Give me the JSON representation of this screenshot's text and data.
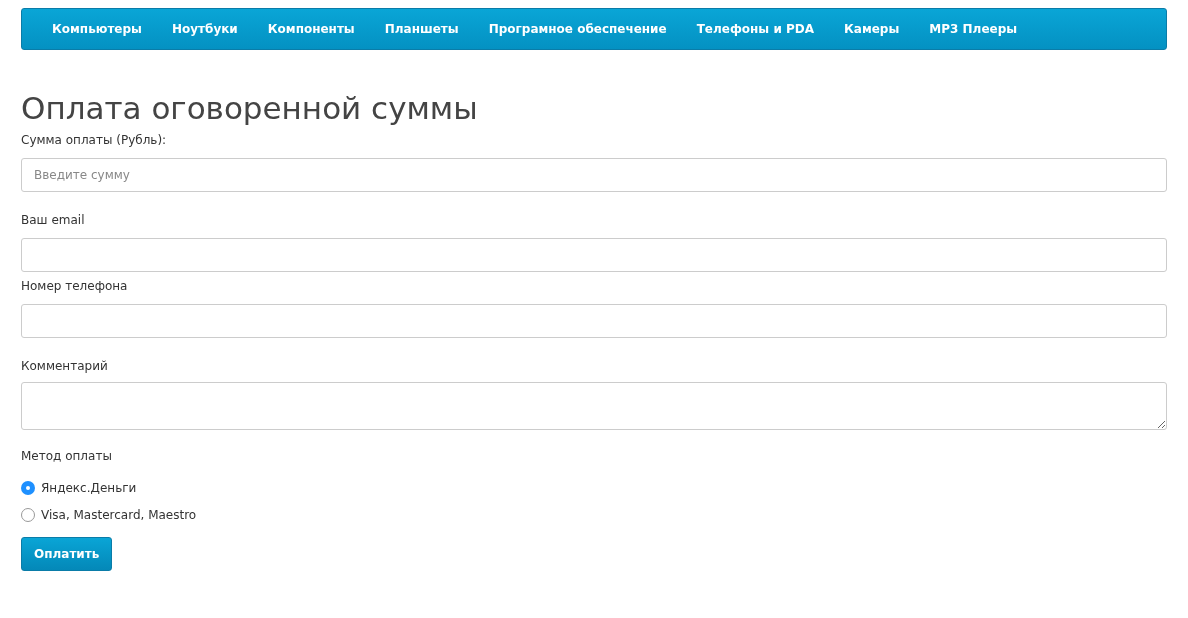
{
  "nav": {
    "items": [
      {
        "label": "Компьютеры"
      },
      {
        "label": "Ноутбуки"
      },
      {
        "label": "Компоненты"
      },
      {
        "label": "Планшеты"
      },
      {
        "label": "Програмное обеспечение"
      },
      {
        "label": "Телефоны и PDA"
      },
      {
        "label": "Камеры"
      },
      {
        "label": "MP3 Плееры"
      }
    ]
  },
  "title": "Оплата оговоренной суммы",
  "fields": [
    {
      "kind": "input",
      "label": "Сумма оплаты (Рубль):",
      "placeholder": "Введите сумму"
    },
    {
      "kind": "input",
      "label": "Ваш email"
    },
    {
      "kind": "input",
      "label": "Номер телефона"
    },
    {
      "kind": "textarea",
      "label": "Комментарий"
    }
  ],
  "payment_method": {
    "label": "Метод оплаты",
    "options": [
      {
        "label": "Яндекс.Деньги",
        "selected": true
      },
      {
        "label": "Visa, Mastercard, Maestro",
        "selected": false
      }
    ]
  },
  "submit_button": "Оплатить"
}
